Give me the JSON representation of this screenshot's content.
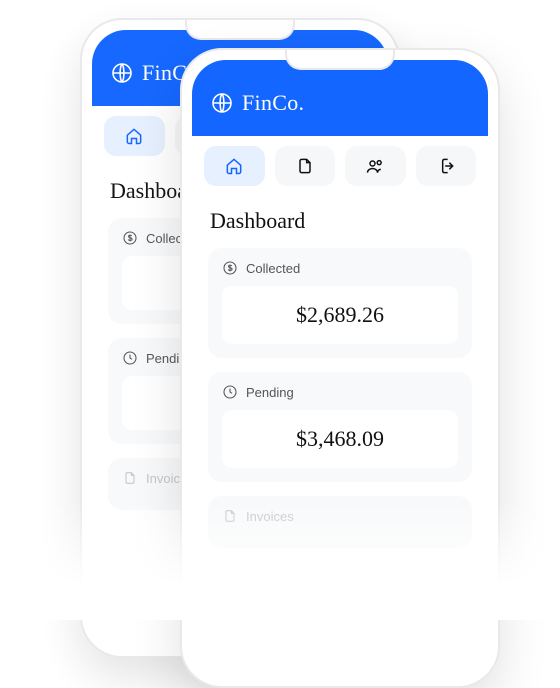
{
  "brand": "FinCo.",
  "nav": {
    "home": "home",
    "docs": "docs",
    "users": "users",
    "logout": "logout"
  },
  "back": {
    "page_title": "Dashboard",
    "cards": {
      "collected": {
        "label": "Collected",
        "value": ""
      },
      "pending": {
        "label": "Pending",
        "value": ""
      },
      "invoices": {
        "label": "Invoices"
      }
    }
  },
  "front": {
    "page_title": "Dashboard",
    "cards": {
      "collected": {
        "label": "Collected",
        "value": "$2,689.26"
      },
      "pending": {
        "label": "Pending",
        "value": "$3,468.09"
      },
      "invoices": {
        "label": "Invoices"
      }
    }
  }
}
